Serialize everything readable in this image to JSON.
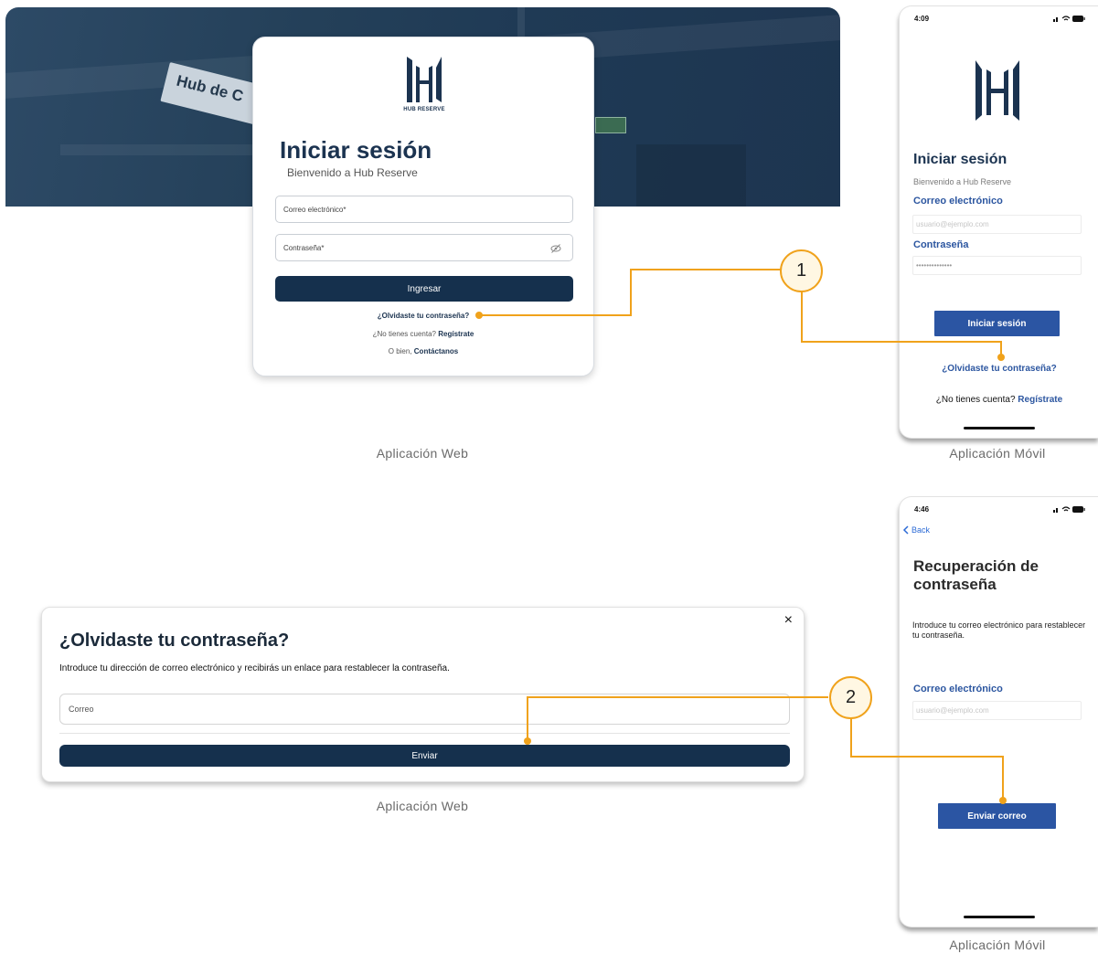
{
  "web_login": {
    "hero_sign_text": "Hub de C",
    "logo_text": "HUB RESERVE",
    "title": "Iniciar sesión",
    "subtitle": "Bienvenido a Hub Reserve",
    "email_label": "Correo electrónico",
    "password_label": "Contraseña",
    "required_mark": "*",
    "submit_label": "Ingresar",
    "forgot_link": "¿Olvidaste tu contraseña?",
    "no_account_text": "¿No tienes cuenta?",
    "register_link": "Regístrate",
    "or_text": "O bien,",
    "contact_link": "Contáctanos",
    "caption": "Aplicación Web"
  },
  "mobile_login": {
    "status_time": "4:09",
    "title": "Iniciar sesión",
    "subtitle": "Bienvenido a Hub Reserve",
    "email_label": "Correo electrónico",
    "email_placeholder": "usuario@ejemplo.com",
    "password_label": "Contraseña",
    "password_value": "••••••••••••••",
    "submit_label": "Iniciar sesión",
    "forgot_link": "¿Olvidaste tu contraseña?",
    "no_account_text": "¿No tienes cuenta?",
    "register_link": "Regístrate",
    "caption": "Aplicación Móvil"
  },
  "web_forgot": {
    "close": "×",
    "title": "¿Olvidaste tu contraseña?",
    "description": "Introduce tu dirección de correo electrónico y recibirás un enlace para restablecer la contraseña.",
    "email_placeholder": "Correo",
    "submit_label": "Enviar",
    "caption": "Aplicación Web"
  },
  "mobile_recovery": {
    "status_time": "4:46",
    "back_label": "Back",
    "title_line1": "Recuperación de",
    "title_line2": "contraseña",
    "description": "Introduce tu correo electrónico para restablecer tu contraseña.",
    "email_label": "Correo electrónico",
    "email_placeholder": "usuario@ejemplo.com",
    "submit_label": "Enviar correo",
    "caption": "Aplicación Móvil"
  },
  "annotations": {
    "badge_1": "1",
    "badge_2": "2",
    "accent_color": "#f0a21b"
  },
  "colors": {
    "navy": "#15304d",
    "mobile_blue": "#2b55a3"
  }
}
